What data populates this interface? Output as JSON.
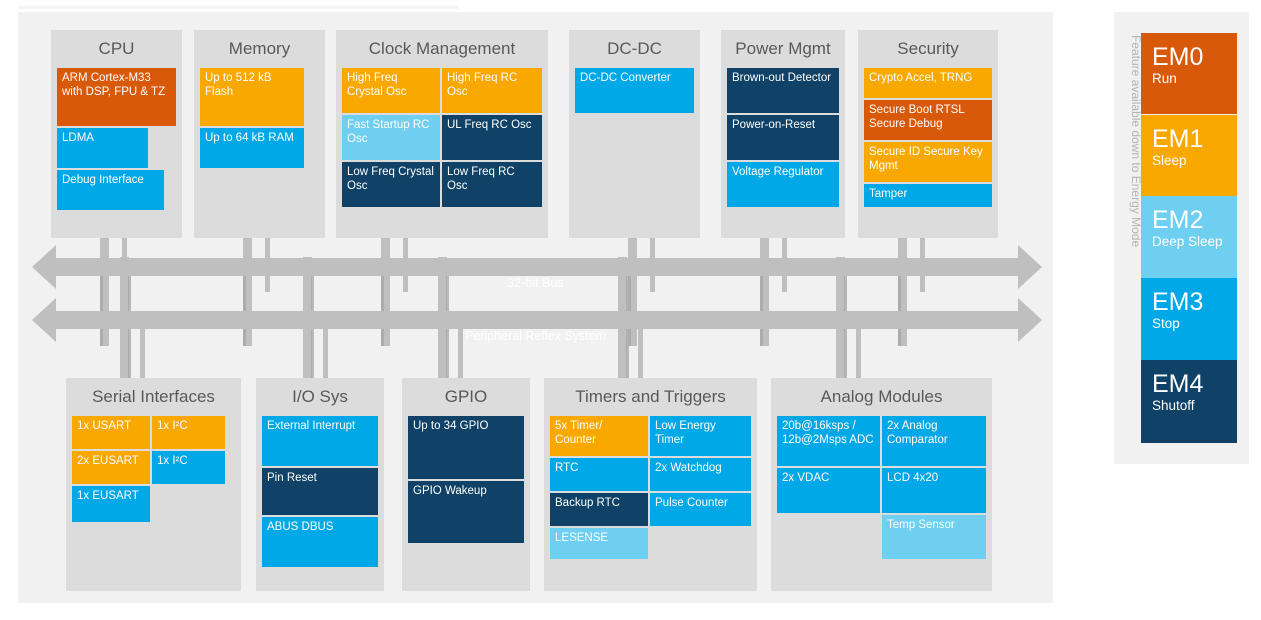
{
  "diagram": {
    "title_hidden": "",
    "buses": [
      {
        "label": "32-bit Bus"
      },
      {
        "label": "Peripheral Reflex System"
      }
    ],
    "colors": {
      "orange": "#d9590b",
      "amber": "#f9a800",
      "light_blue": "#6fcff0",
      "blue": "#00a8e8",
      "navy": "#0f4266",
      "group_bg": "#dcdcdc",
      "panel_bg": "#f1f1f1"
    },
    "top_groups": [
      {
        "name": "CPU",
        "blocks": [
          {
            "label": "ARM Cortex-M33 with DSP, FPU & TZ",
            "color": "orange"
          },
          {
            "label": "LDMA",
            "color": "blue"
          },
          {
            "label": "Debug Interface",
            "color": "blue"
          }
        ]
      },
      {
        "name": "Memory",
        "blocks": [
          {
            "label": "Up to 512 kB Flash",
            "color": "amber"
          },
          {
            "label": "Up to 64 kB RAM",
            "color": "blue"
          }
        ]
      },
      {
        "name": "Clock Management",
        "blocks": [
          {
            "label": "High Freq Crystal Osc",
            "color": "amber"
          },
          {
            "label": "High Freq RC Osc",
            "color": "amber"
          },
          {
            "label": "Fast Startup RC Osc",
            "color": "light_blue"
          },
          {
            "label": "UL Freq RC Osc",
            "color": "navy"
          },
          {
            "label": "Low Freq Crystal Osc",
            "color": "navy"
          },
          {
            "label": "Low Freq RC Osc",
            "color": "navy"
          }
        ]
      },
      {
        "name": "DC-DC",
        "blocks": [
          {
            "label": "DC-DC Converter",
            "color": "blue"
          }
        ]
      },
      {
        "name": "Power Mgmt",
        "blocks": [
          {
            "label": "Brown-out Detector",
            "color": "navy"
          },
          {
            "label": "Power-on-Reset",
            "color": "navy"
          },
          {
            "label": "Voltage Regulator",
            "color": "blue"
          }
        ]
      },
      {
        "name": "Security",
        "blocks": [
          {
            "label": "Crypto Accel, TRNG",
            "color": "amber"
          },
          {
            "label": "Secure Boot RTSL Secure Debug",
            "color": "orange"
          },
          {
            "label": "Secure ID Secure Key Mgmt",
            "color": "amber"
          },
          {
            "label": "Tamper",
            "color": "blue"
          }
        ]
      }
    ],
    "bottom_groups": [
      {
        "name": "Serial Interfaces",
        "blocks": [
          {
            "label": "1x USART",
            "color": "amber"
          },
          {
            "label": "1x I²C",
            "color": "amber"
          },
          {
            "label": "2x EUSART",
            "color": "amber"
          },
          {
            "label": "1x I²C",
            "color": "blue"
          },
          {
            "label": "1x EUSART",
            "color": "blue"
          }
        ]
      },
      {
        "name": "I/O Sys",
        "blocks": [
          {
            "label": "External Interrupt",
            "color": "blue"
          },
          {
            "label": "Pin Reset",
            "color": "navy"
          },
          {
            "label": "ABUS DBUS",
            "color": "blue"
          }
        ]
      },
      {
        "name": "GPIO",
        "blocks": [
          {
            "label": "Up to 34 GPIO",
            "color": "navy"
          },
          {
            "label": "GPIO Wakeup",
            "color": "navy"
          }
        ]
      },
      {
        "name": "Timers and Triggers",
        "blocks": [
          {
            "label": "5x Timer/ Counter",
            "color": "amber"
          },
          {
            "label": "Low Energy Timer",
            "color": "blue"
          },
          {
            "label": "RTC",
            "color": "blue"
          },
          {
            "label": "2x Watchdog",
            "color": "blue"
          },
          {
            "label": "Backup RTC",
            "color": "navy"
          },
          {
            "label": "Pulse Counter",
            "color": "blue"
          },
          {
            "label": "LESENSE",
            "color": "light_blue"
          }
        ]
      },
      {
        "name": "Analog Modules",
        "blocks": [
          {
            "label": "20b@16ksps / 12b@2Msps ADC",
            "color": "blue"
          },
          {
            "label": "2x Analog Comparator",
            "color": "blue"
          },
          {
            "label": "2x VDAC",
            "color": "blue"
          },
          {
            "label": "LCD 4x20",
            "color": "blue"
          },
          {
            "label": "Temp Sensor",
            "color": "light_blue"
          }
        ]
      }
    ],
    "energy_modes": {
      "caption": "Feature available down to Energy Mode",
      "items": [
        {
          "name": "EM0",
          "sub": "Run",
          "color": "#d9590b"
        },
        {
          "name": "EM1",
          "sub": "Sleep",
          "color": "#f9a800"
        },
        {
          "name": "EM2",
          "sub": "Deep Sleep",
          "color": "#6fcff0"
        },
        {
          "name": "EM3",
          "sub": "Stop",
          "color": "#00a8e8"
        },
        {
          "name": "EM4",
          "sub": "Shutoff",
          "color": "#0f4266"
        }
      ]
    }
  }
}
